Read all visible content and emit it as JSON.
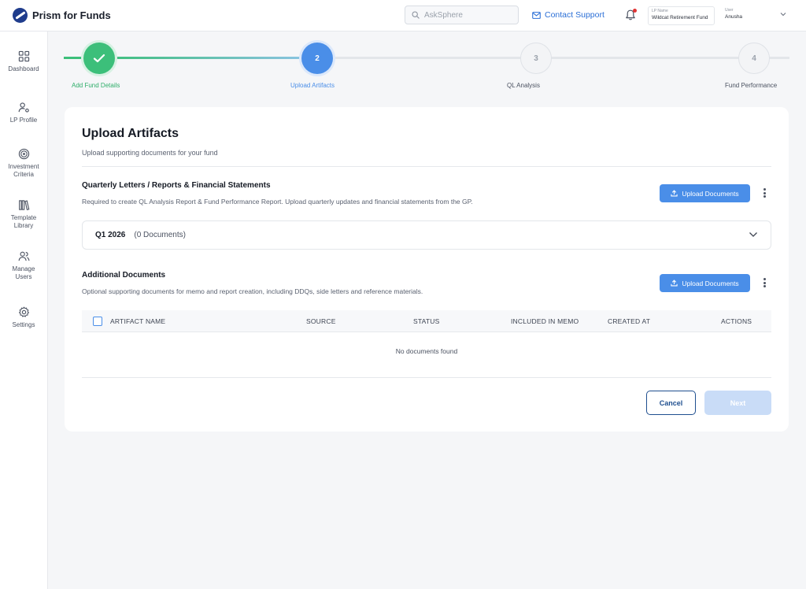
{
  "app": {
    "name": "Prism for Funds"
  },
  "header": {
    "search_placeholder": "AskSphere",
    "contact_label": "Contact Support",
    "lp": {
      "caption": "LP Name",
      "value": "Wildcat Retirement Fund"
    },
    "user": {
      "caption": "User",
      "value": "Anusha"
    }
  },
  "sidebar": {
    "items": [
      {
        "label": "Dashboard",
        "icon": "grid-icon"
      },
      {
        "label": "LP Profile",
        "icon": "user-settings-icon"
      },
      {
        "label": "Investment Criteria",
        "icon": "target-icon"
      },
      {
        "label": "Template Library",
        "icon": "library-icon"
      },
      {
        "label": "Manage Users",
        "icon": "users-icon"
      },
      {
        "label": "Settings",
        "icon": "gear-icon"
      }
    ]
  },
  "stepper": {
    "steps": [
      {
        "number": "1",
        "label": "Add Fund Details",
        "state": "complete"
      },
      {
        "number": "2",
        "label": "Upload Artifacts",
        "state": "current"
      },
      {
        "number": "3",
        "label": "QL Analysis",
        "state": "pending"
      },
      {
        "number": "4",
        "label": "Fund Performance",
        "state": "pending"
      }
    ]
  },
  "card": {
    "title": "Upload Artifacts",
    "subtitle": "Upload supporting documents for your fund",
    "quarterly": {
      "title": "Quarterly Letters / Reports & Financial Statements",
      "description": "Required to create QL Analysis Report & Fund Performance Report. Upload quarterly updates and financial statements from the GP.",
      "upload_label": "Upload Documents",
      "group": {
        "name": "Q1 2026",
        "count": "(0 Documents)"
      }
    },
    "additional": {
      "title": "Additional Documents",
      "description": "Optional supporting documents for memo and report creation, including DDQs, side letters and reference materials.",
      "upload_label": "Upload Documents"
    },
    "table": {
      "columns": [
        "ARTIFACT NAME",
        "SOURCE",
        "STATUS",
        "INCLUDED IN MEMO",
        "CREATED AT",
        "ACTIONS"
      ],
      "empty_text": "No documents found"
    },
    "actions": {
      "cancel": "Cancel",
      "next": "Next"
    }
  },
  "colors": {
    "primary": "#4a8ee8",
    "success": "#3cbf7a",
    "link": "#2b6fd6",
    "notification": "#e03434"
  }
}
